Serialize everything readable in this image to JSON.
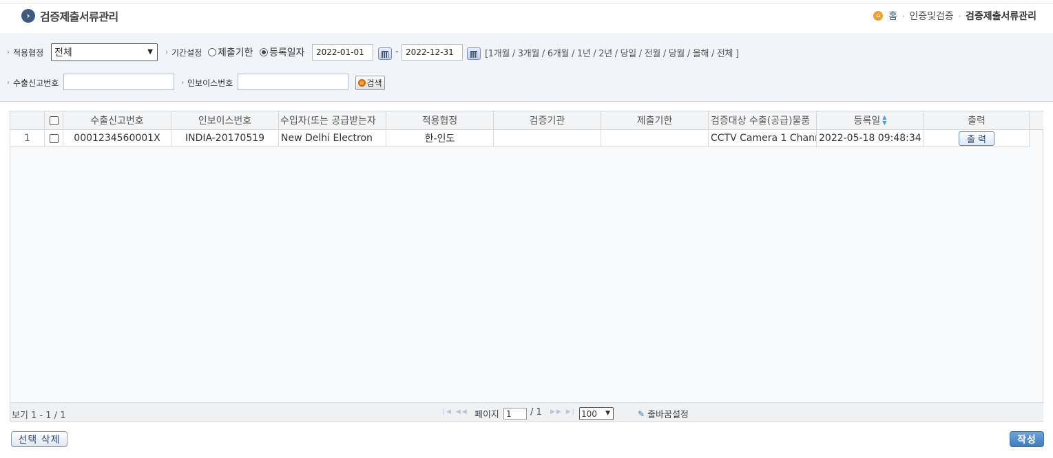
{
  "header": {
    "title": "검증제출서류관리",
    "breadcrumb": [
      "홈",
      "인증및검증",
      "검증제출서류관리"
    ]
  },
  "search": {
    "agreement_label": "적용협정",
    "agreement_value": "전체",
    "period_label": "기간설정",
    "radio_deadline": "제출기한",
    "radio_regdate": "등록일자",
    "radio_selected": "등록일자",
    "date_from": "2022-01-01",
    "date_to": "2022-12-31",
    "date_sep": "-",
    "quick_ranges": "[1개월 / 3개월 / 6개월 / 1년 / 2년 / 당일 / 전월 / 당월 / 올해 / 전체 ]",
    "export_no_label": "수출신고번호",
    "export_no_value": "",
    "invoice_no_label": "인보이스번호",
    "invoice_no_value": "",
    "search_button": "검색"
  },
  "grid": {
    "columns": [
      "수출신고번호",
      "인보이스번호",
      "수입자(또는 공급받는자",
      "적용협정",
      "검증기관",
      "제출기한",
      "검증대상 수출(공급)물품",
      "등록일",
      "출력"
    ],
    "rows": [
      {
        "no": "1",
        "export_no": "0001234560001X",
        "invoice_no": "INDIA-20170519",
        "importer": "New Delhi Electron",
        "agreement": "한-인도",
        "agency": "",
        "deadline": "",
        "goods": "CCTV Camera 1 Chann",
        "reg_date": "2022-05-18 09:48:34",
        "print_label": "출 력"
      }
    ]
  },
  "pager": {
    "view_info": "보기 1 - 1 / 1",
    "page_label": "페이지",
    "page_value": "1",
    "page_total": "/ 1",
    "page_size": "100",
    "column_setting": "줄바꿈설정"
  },
  "footer": {
    "delete_button": "선택 삭제",
    "write_button": "작성"
  },
  "colors": {
    "primary": "#3d5a80",
    "panel_bg": "#f1f4f8",
    "write_button": "#4a86c2"
  }
}
